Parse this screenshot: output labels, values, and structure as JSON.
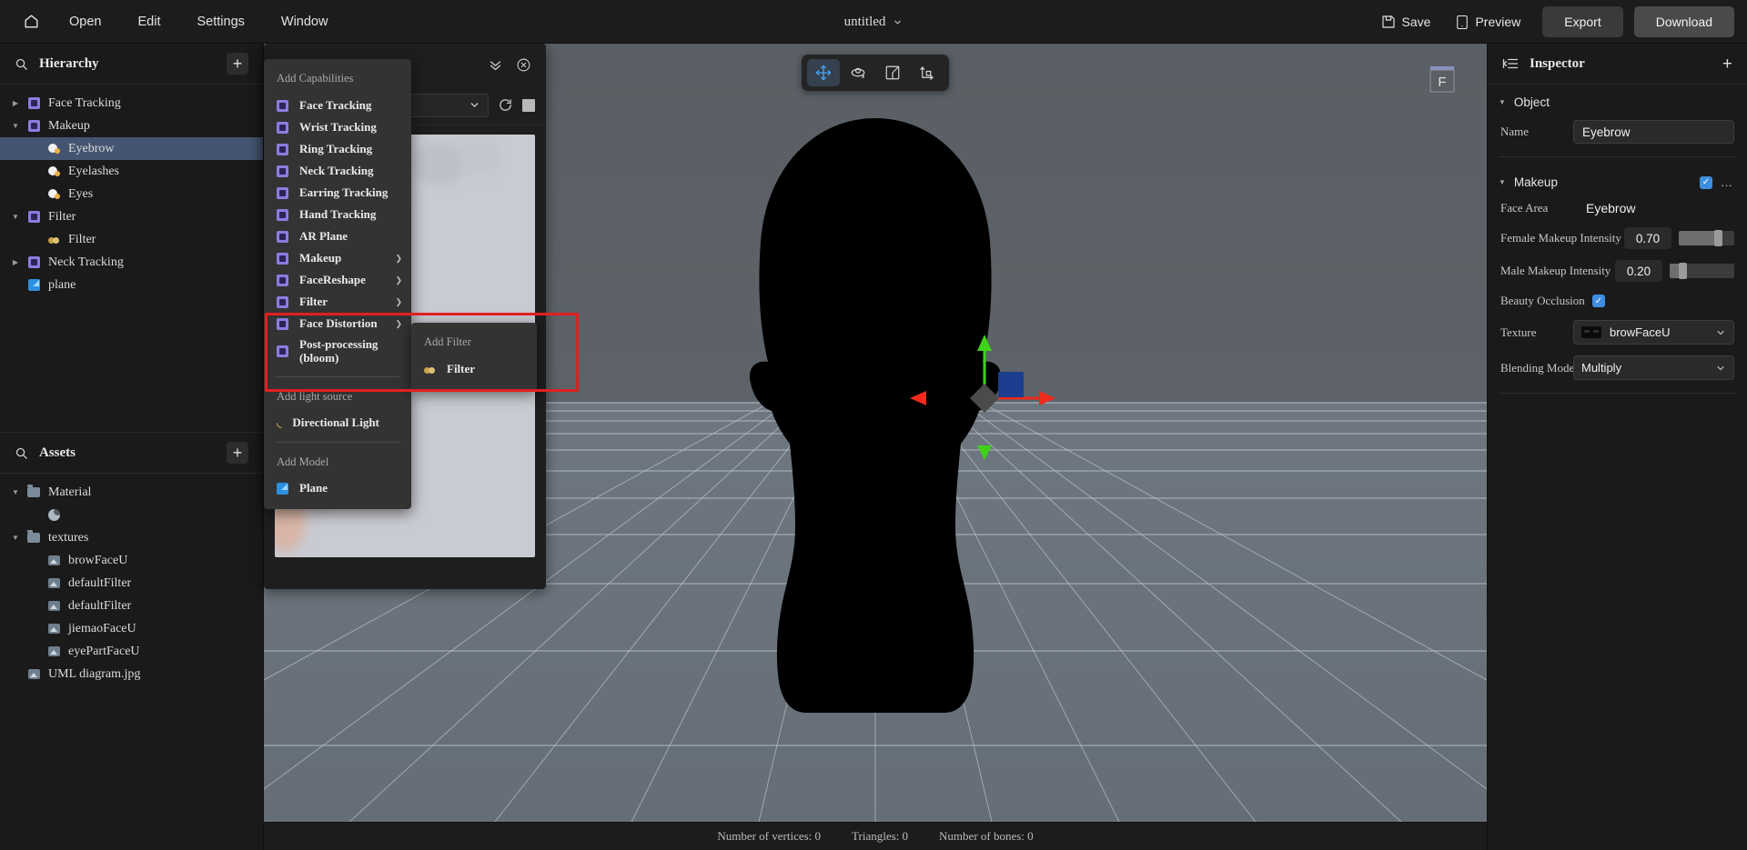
{
  "topbar": {
    "home_icon": "home-icon",
    "menus": [
      "Open",
      "Edit",
      "Settings",
      "Window"
    ],
    "title": "untitled",
    "title_caret": "chevron-down-icon",
    "save_label": "Save",
    "preview_label": "Preview",
    "export_label": "Export",
    "download_label": "Download"
  },
  "hierarchy": {
    "title": "Hierarchy",
    "search_icon": "search-icon",
    "add_icon": "plus-icon",
    "items": [
      {
        "label": "Face Tracking",
        "icon": "capability-icon",
        "depth": 0,
        "arrow": "collapsed",
        "selected": false
      },
      {
        "label": "Makeup",
        "icon": "capability-icon",
        "depth": 0,
        "arrow": "expanded",
        "selected": false
      },
      {
        "label": "Eyebrow",
        "icon": "makeup-icon",
        "depth": 1,
        "arrow": "none",
        "selected": true
      },
      {
        "label": "Eyelashes",
        "icon": "makeup-icon",
        "depth": 1,
        "arrow": "none",
        "selected": false
      },
      {
        "label": "Eyes",
        "icon": "makeup-icon",
        "depth": 1,
        "arrow": "none",
        "selected": false
      },
      {
        "label": "Filter",
        "icon": "capability-icon",
        "depth": 0,
        "arrow": "expanded",
        "selected": false
      },
      {
        "label": "Filter",
        "icon": "filter-icon",
        "depth": 1,
        "arrow": "none",
        "selected": false
      },
      {
        "label": "Neck Tracking",
        "icon": "capability-icon",
        "depth": 0,
        "arrow": "collapsed",
        "selected": false
      },
      {
        "label": "plane",
        "icon": "plane-icon",
        "depth": 0,
        "arrow": "none",
        "selected": false
      }
    ]
  },
  "assets": {
    "title": "Assets",
    "search_icon": "search-icon",
    "add_icon": "plus-icon",
    "items": [
      {
        "label": "Material",
        "icon": "folder-icon",
        "depth": 0,
        "arrow": "expanded"
      },
      {
        "label": "",
        "icon": "material-sphere-icon",
        "depth": 1,
        "arrow": "none"
      },
      {
        "label": "textures",
        "icon": "folder-icon",
        "depth": 0,
        "arrow": "expanded"
      },
      {
        "label": "browFaceU",
        "icon": "texture-icon",
        "depth": 1,
        "arrow": "none"
      },
      {
        "label": "defaultFilter",
        "icon": "texture-icon",
        "depth": 1,
        "arrow": "none"
      },
      {
        "label": "defaultFilter",
        "icon": "texture-icon",
        "depth": 1,
        "arrow": "none"
      },
      {
        "label": "jiemaoFaceU",
        "icon": "texture-icon",
        "depth": 1,
        "arrow": "none"
      },
      {
        "label": "eyePartFaceU",
        "icon": "texture-icon",
        "depth": 1,
        "arrow": "none"
      },
      {
        "label": "UML diagram.jpg",
        "icon": "texture-icon",
        "depth": 0,
        "arrow": "none"
      }
    ]
  },
  "preview_panel": {
    "collapse_icon": "chevron-double-down-icon",
    "close_icon": "close-circle-icon",
    "dropdown_caret": "chevron-down-icon",
    "refresh_icon": "refresh-icon",
    "stop_icon": "stop-square-icon"
  },
  "context_menu": {
    "section_capabilities": "Add Capabilities",
    "capabilities": [
      {
        "label": "Face Tracking",
        "submenu": false
      },
      {
        "label": "Wrist Tracking",
        "submenu": false
      },
      {
        "label": "Ring Tracking",
        "submenu": false
      },
      {
        "label": "Neck Tracking",
        "submenu": false
      },
      {
        "label": "Earring Tracking",
        "submenu": false
      },
      {
        "label": "Hand Tracking",
        "submenu": false
      },
      {
        "label": "AR Plane",
        "submenu": false
      },
      {
        "label": "Makeup",
        "submenu": true
      },
      {
        "label": "FaceReshape",
        "submenu": true
      },
      {
        "label": "Filter",
        "submenu": true
      },
      {
        "label": "Face Distortion",
        "submenu": true
      },
      {
        "label": "Post-processing (bloom)",
        "submenu": false
      }
    ],
    "section_light": "Add light source",
    "lights": [
      {
        "label": "Directional Light"
      }
    ],
    "section_model": "Add Model",
    "models": [
      {
        "label": "Plane"
      }
    ]
  },
  "submenu": {
    "section": "Add Filter",
    "items": [
      {
        "label": "Filter"
      }
    ]
  },
  "viewport": {
    "tools": [
      {
        "name": "move-tool",
        "active": true
      },
      {
        "name": "rotate-tool",
        "active": false
      },
      {
        "name": "scale-tool",
        "active": false
      },
      {
        "name": "transform-tool",
        "active": false
      }
    ],
    "axis_label": "F"
  },
  "statusbar": {
    "vertices": "Number of vertices: 0",
    "triangles": "Triangles: 0",
    "bones": "Number of bones: 0"
  },
  "inspector": {
    "title": "Inspector",
    "list_icon": "list-icon",
    "add_icon": "plus-icon",
    "object_section": "Object",
    "name_label": "Name",
    "name_value": "Eyebrow",
    "makeup_section": "Makeup",
    "makeup_enabled": true,
    "more_icon": "ellipsis-icon",
    "face_area_label": "Face Area",
    "face_area_value": "Eyebrow",
    "female_label": "Female Makeup Intensity",
    "female_value": "0.70",
    "female_pct": 70,
    "male_label": "Male Makeup Intensity",
    "male_value": "0.20",
    "male_pct": 20,
    "beauty_occlusion_label": "Beauty Occlusion",
    "beauty_occlusion_checked": true,
    "texture_label": "Texture",
    "texture_value": "browFaceU",
    "blending_label": "Blending Mode",
    "blending_value": "Multiply"
  },
  "colors": {
    "accent_blue": "#3e8ee0",
    "selection": "#445571",
    "highlight_red": "#e02020",
    "capability_purple": "#8a7de0",
    "panel_bg": "#1a1a1a",
    "menu_bg": "#333333"
  }
}
